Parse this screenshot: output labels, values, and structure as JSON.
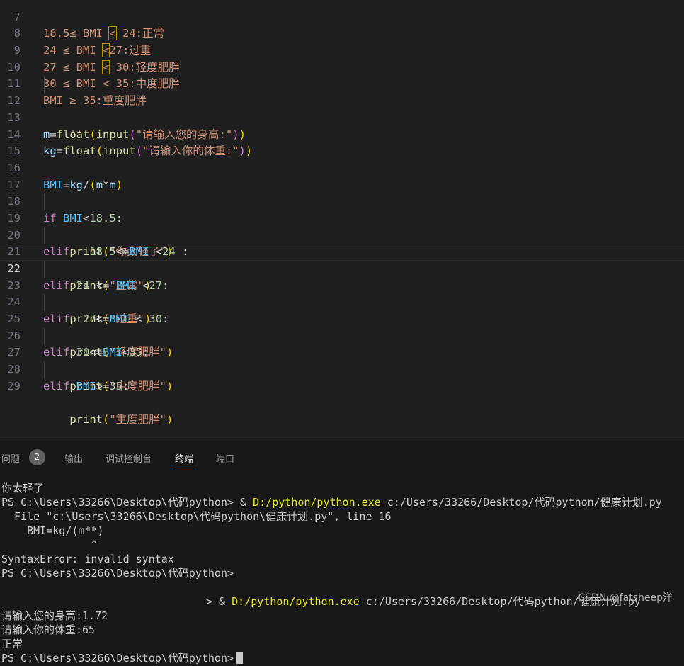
{
  "editor": {
    "lines": [
      {
        "n": "7",
        "text": "18.5≤ BMI < 24:正常"
      },
      {
        "n": "8",
        "text": "24 ≤ BMI <27:过重"
      },
      {
        "n": "9",
        "text": "27 ≤ BMI < 30:轻度肥胖"
      },
      {
        "n": "10",
        "text": "30 ≤ BMI < 35:中度肥胖"
      },
      {
        "n": "11",
        "text": "BMI ≥ 35:重度肥胖"
      },
      {
        "n": "12",
        "text": "    '''"
      },
      {
        "n": "13",
        "text": "m=float(input(\"请输入您的身高:\"))"
      },
      {
        "n": "14",
        "text": "kg=float(input(\"请输入你的体重:\"))"
      },
      {
        "n": "15",
        "text": ""
      },
      {
        "n": "16",
        "text": "BMI=kg/(m*m)"
      },
      {
        "n": "17",
        "text": ""
      },
      {
        "n": "18",
        "text": "if BMI<18.5:"
      },
      {
        "n": "19",
        "text": "    print(\"你太轻了\")"
      },
      {
        "n": "20",
        "text": "elif   18.5<=BMI <24 :"
      },
      {
        "n": "21",
        "text": "    print(\"正常\")"
      },
      {
        "n": "22",
        "text": "elif 24 <= BMI <27:"
      },
      {
        "n": "23",
        "text": "    print(\"过重\")"
      },
      {
        "n": "24",
        "text": "elif  27<=BMI < 30:"
      },
      {
        "n": "25",
        "text": "    print(\"轻度肥胖\")"
      },
      {
        "n": "26",
        "text": "elif 30<=BMI<35:"
      },
      {
        "n": "27",
        "text": "    print(\"中度肥胖\")"
      },
      {
        "n": "28",
        "text": "elif BMI>=35:"
      },
      {
        "n": "29",
        "text": "    print(\"重度肥胖\")"
      }
    ]
  },
  "panel": {
    "tabs": [
      {
        "label": "问题",
        "active": false
      },
      {
        "label": "输出",
        "active": false
      },
      {
        "label": "调试控制台",
        "active": false
      },
      {
        "label": "终端",
        "active": true
      },
      {
        "label": "端口",
        "active": false
      }
    ],
    "problems_count": "2"
  },
  "terminal": {
    "line1": "你太轻了",
    "line2_prompt": "PS C:\\Users\\33266\\Desktop\\代码python> & ",
    "line2_exe": "D:/python/python.exe",
    "line2_arg": " c:/Users/33266/Desktop/代码python/健康计划.py",
    "line3": "  File \"c:\\Users\\33266\\Desktop\\代码python\\健康计划.py\", line 16",
    "line4": "    BMI=kg/(m**)",
    "line5": "              ^",
    "line6": "SyntaxError: invalid syntax",
    "line7": "PS C:\\Users\\33266\\Desktop\\代码python>",
    "line8": "",
    "line9_prompt": "                                > & ",
    "line9_exe": "D:/python/python.exe",
    "line9_arg": " c:/Users/33266/Desktop/代码python/健康计划.py",
    "line10": "请输入您的身高:1.72",
    "line11": "请输入你的体重:65",
    "line12": "正常",
    "line13": "PS C:\\Users\\33266\\Desktop\\代码python>"
  },
  "watermark": "CSDN @fatsheep洋"
}
